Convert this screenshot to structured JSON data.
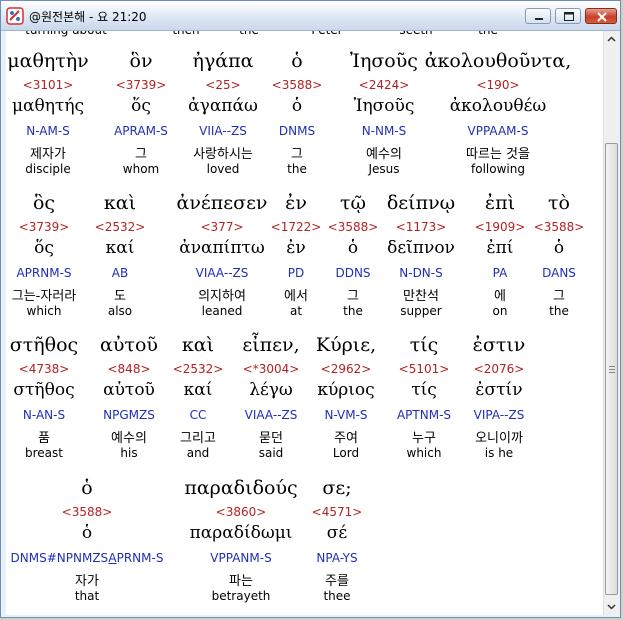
{
  "window": {
    "title": "@원전본해 - 요 21:20",
    "buttons": [
      "minimize",
      "maximize",
      "close"
    ]
  },
  "prev_line": [
    "turning about",
    "then",
    "the",
    "Peter",
    "seeth",
    "the"
  ],
  "rows": [
    {
      "words": [
        {
          "greek": "μαθητὴν",
          "strong": "<3101>",
          "lexeme": "μαθητής",
          "parse": "N-AM-S",
          "korean": "제자가",
          "english": "disciple"
        },
        {
          "greek": "ὃν",
          "strong": "<3739>",
          "lexeme": "ὅς",
          "parse": "APRAM-S",
          "korean": "그",
          "english": "whom"
        },
        {
          "greek": "ἠγάπα",
          "strong": "<25>",
          "lexeme": "ἀγαπάω",
          "parse": "VIIA--ZS",
          "korean": "사랑하시는",
          "english": "loved"
        },
        {
          "greek": "ὁ",
          "strong": "<3588>",
          "lexeme": "ὁ",
          "parse": "DNMS",
          "korean": "그",
          "english": "the"
        },
        {
          "greek": "Ἰησοῦς",
          "strong": "<2424>",
          "lexeme": "Ἰησοῦς",
          "parse": "N-NM-S",
          "korean": "예수의",
          "english": "Jesus"
        },
        {
          "greek": "ἀκολουθοῦντα,",
          "strong": "<190>",
          "lexeme": "ἀκολουθέω",
          "parse": "VPPAAM-S",
          "korean": "따르는 것을",
          "english": "following"
        }
      ]
    },
    {
      "words": [
        {
          "greek": "ὃς",
          "strong": "<3739>",
          "lexeme": "ὅς",
          "parse": "APRNM-S",
          "korean": "그는-자러라",
          "english": "which"
        },
        {
          "greek": "καὶ",
          "strong": "<2532>",
          "lexeme": "καί",
          "parse": "AB",
          "korean": "도",
          "english": "also"
        },
        {
          "greek": "ἀνέπεσεν",
          "strong": "<377>",
          "lexeme": "ἀναπίπτω",
          "parse": "VIAA--ZS",
          "korean": "의지하여",
          "english": "leaned"
        },
        {
          "greek": "ἐν",
          "strong": "<1722>",
          "lexeme": "ἐν",
          "parse": "PD",
          "korean": "에서",
          "english": "at"
        },
        {
          "greek": "τῷ",
          "strong": "<3588>",
          "lexeme": "ὁ",
          "parse": "DDNS",
          "korean": "그",
          "english": "the"
        },
        {
          "greek": "δείπνῳ",
          "strong": "<1173>",
          "lexeme": "δεῖπνον",
          "parse": "N-DN-S",
          "korean": "만찬석",
          "english": "supper"
        },
        {
          "greek": "ἐπὶ",
          "strong": "<1909>",
          "lexeme": "ἐπί",
          "parse": "PA",
          "korean": "에",
          "english": "on"
        },
        {
          "greek": "τὸ",
          "strong": "<3588>",
          "lexeme": "ὁ",
          "parse": "DANS",
          "korean": "그",
          "english": "the"
        }
      ]
    },
    {
      "words": [
        {
          "greek": "στῆθος",
          "strong": "<4738>",
          "lexeme": "στῆθος",
          "parse": "N-AN-S",
          "korean": "품",
          "english": "breast"
        },
        {
          "greek": "αὐτοῦ",
          "strong": "<848>",
          "lexeme": "αὑτοῦ",
          "parse": "NPGMZS",
          "korean": "예수의",
          "english": "his"
        },
        {
          "greek": "καὶ",
          "strong": "<2532>",
          "lexeme": "καί",
          "parse": "CC",
          "korean": "그리고",
          "english": "and"
        },
        {
          "greek": "εἶπεν,",
          "strong": "<*3004>",
          "lexeme": "λέγω",
          "parse": "VIAA--ZS",
          "korean": "묻던",
          "english": "said"
        },
        {
          "greek": "Κύριε,",
          "strong": "<2962>",
          "lexeme": "κύριος",
          "parse": "N-VM-S",
          "korean": "주여",
          "english": "Lord"
        },
        {
          "greek": "τίς",
          "strong": "<5101>",
          "lexeme": "τίς",
          "parse": "APTNM-S",
          "korean": "누구",
          "english": "which"
        },
        {
          "greek": "ἐστιν",
          "strong": "<2076>",
          "lexeme": "ἐστίν",
          "parse": "VIPA--ZS",
          "korean": "오니이까",
          "english": "is he"
        }
      ]
    },
    {
      "words": [
        {
          "greek": "ὁ",
          "strong": "<3588>",
          "lexeme": "ὁ",
          "parse": "DNMS#NPNMZS&APRNM-S",
          "korean": "자가",
          "english": "that"
        },
        {
          "greek": "παραδιδούς",
          "strong": "<3860>",
          "lexeme": "παραδίδωμι",
          "parse": "VPPANM-S",
          "korean": "파는",
          "english": "betrayeth"
        },
        {
          "greek": "σε;",
          "strong": "<4571>",
          "lexeme": "σέ",
          "parse": "NPA-YS",
          "korean": "주를",
          "english": "thee"
        }
      ]
    }
  ]
}
